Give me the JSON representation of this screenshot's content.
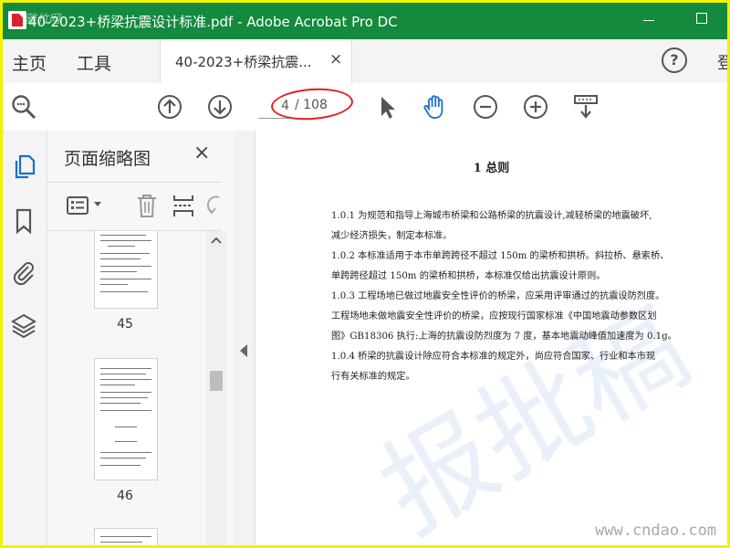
{
  "window": {
    "title": "40-2023+桥梁抗震设计标准.pdf - Adobe Acrobat Pro DC",
    "watermark": "雅竹网"
  },
  "menu": {
    "home": "主页",
    "tools": "工具",
    "doc_tab": "40-2023+桥梁抗震...",
    "close": "×",
    "help": "?",
    "login": "登"
  },
  "toolbar": {
    "current_page": "4",
    "total_pages": "/ 108"
  },
  "panel": {
    "title": "页面缩略图",
    "close": "×",
    "thumbnails": [
      {
        "page": "45"
      },
      {
        "page": "46"
      }
    ]
  },
  "document": {
    "heading": "1   总则",
    "paragraphs": [
      "1.0.1 为规范和指导上海城市桥梁和公路桥梁的抗震设计,减轻桥梁的地震破坏,",
      "减少经济损失，制定本标准。",
      "1.0.2 本标准适用于本市单跨跨径不超过 150m 的梁桥和拱桥。斜拉桥、悬索桥、",
      "单跨跨径超过 150m 的梁桥和拱桥，本标准仅给出抗震设计原则。",
      "1.0.3 工程场地已做过地震安全性评价的桥梁，应采用评审通过的抗震设防烈度。",
      "工程场地未做地震安全性评价的桥梁，应按现行国家标准《中国地震动参数区划",
      "图》GB18306 执行:上海的抗震设防烈度为 7 度，基本地震动峰值加速度为 0.1g。",
      "1.0.4 桥梁的抗震设计除应符合本标准的规定外，尚应符合国家、行业和本市现",
      "行有关标准的规定。"
    ],
    "bg_watermark": "报批稿",
    "site_watermark": "www.cndao.com"
  },
  "colors": {
    "titlebar": "#138a3e",
    "annotation": "#e41e1e",
    "border": "#f2f200"
  },
  "icons": [
    "zoom-icon",
    "page-up-icon",
    "page-down-icon",
    "select-arrow-icon",
    "hand-icon",
    "zoom-out-icon",
    "zoom-in-icon",
    "keyboard-scroll-icon",
    "copy-pages-icon",
    "bookmark-icon",
    "attachment-icon",
    "layers-icon",
    "options-list-icon",
    "trash-icon",
    "insert-page-icon",
    "undo-icon"
  ]
}
